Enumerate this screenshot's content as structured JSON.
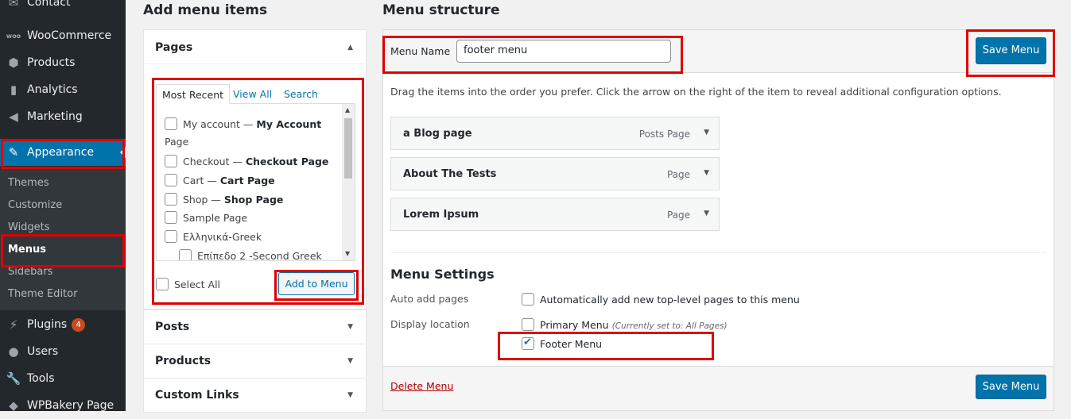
{
  "sidebar": {
    "items": [
      {
        "label": "Contact",
        "icon": "envelope-icon"
      },
      {
        "label": "WooCommerce",
        "icon": "woo-icon"
      },
      {
        "label": "Products",
        "icon": "box-icon"
      },
      {
        "label": "Analytics",
        "icon": "bar-chart-icon"
      },
      {
        "label": "Marketing",
        "icon": "megaphone-icon"
      },
      {
        "label": "Appearance",
        "icon": "brush-icon"
      },
      {
        "label": "Plugins",
        "icon": "plug-icon",
        "badge": "4"
      },
      {
        "label": "Users",
        "icon": "user-icon"
      },
      {
        "label": "Tools",
        "icon": "wrench-icon"
      },
      {
        "label": "WPBakery Page",
        "icon": "wpbakery-icon"
      }
    ],
    "submenu": [
      "Themes",
      "Customize",
      "Widgets",
      "Menus",
      "Sidebars",
      "Theme Editor"
    ]
  },
  "left": {
    "heading": "Add menu items",
    "pages_title": "Pages",
    "tabs": [
      "Most Recent",
      "View All",
      "Search"
    ],
    "pages": [
      {
        "plain": "My account — ",
        "bold": "My Account",
        "plain2": "",
        "extra": "Page"
      },
      {
        "plain": "Checkout — ",
        "bold": "Checkout Page"
      },
      {
        "plain": "Cart — ",
        "bold": "Cart Page"
      },
      {
        "plain": "Shop — ",
        "bold": "Shop Page"
      },
      {
        "plain": "Sample Page",
        "bold": ""
      },
      {
        "plain": "Ελληνικά-Greek",
        "bold": ""
      },
      {
        "plain": "Επίπεδο 2 -Second Greek",
        "bold": ""
      }
    ],
    "select_all": "Select All",
    "add_button": "Add to Menu",
    "sections": [
      "Posts",
      "Products",
      "Custom Links"
    ]
  },
  "right": {
    "heading": "Menu structure",
    "menu_name_label": "Menu Name",
    "menu_name_value": "footer menu",
    "save_label": "Save Menu",
    "instructions": "Drag the items into the order you prefer. Click the arrow on the right of the item to reveal additional configuration options.",
    "items": [
      {
        "title": "a Blog page",
        "type": "Posts Page"
      },
      {
        "title": "About The Tests",
        "type": "Page"
      },
      {
        "title": "Lorem Ipsum",
        "type": "Page"
      }
    ],
    "settings_title": "Menu Settings",
    "auto_add_label": "Auto add pages",
    "auto_add_option": "Automatically add new top-level pages to this menu",
    "display_location_label": "Display location",
    "primary_menu": "Primary Menu",
    "primary_note": "(Currently set to: All Pages)",
    "footer_menu": "Footer Menu",
    "delete_label": "Delete Menu"
  },
  "colors": {
    "accent": "#0073aa",
    "sidebar": "#23282d",
    "highlight": "#e00000",
    "delete": "#a00"
  }
}
